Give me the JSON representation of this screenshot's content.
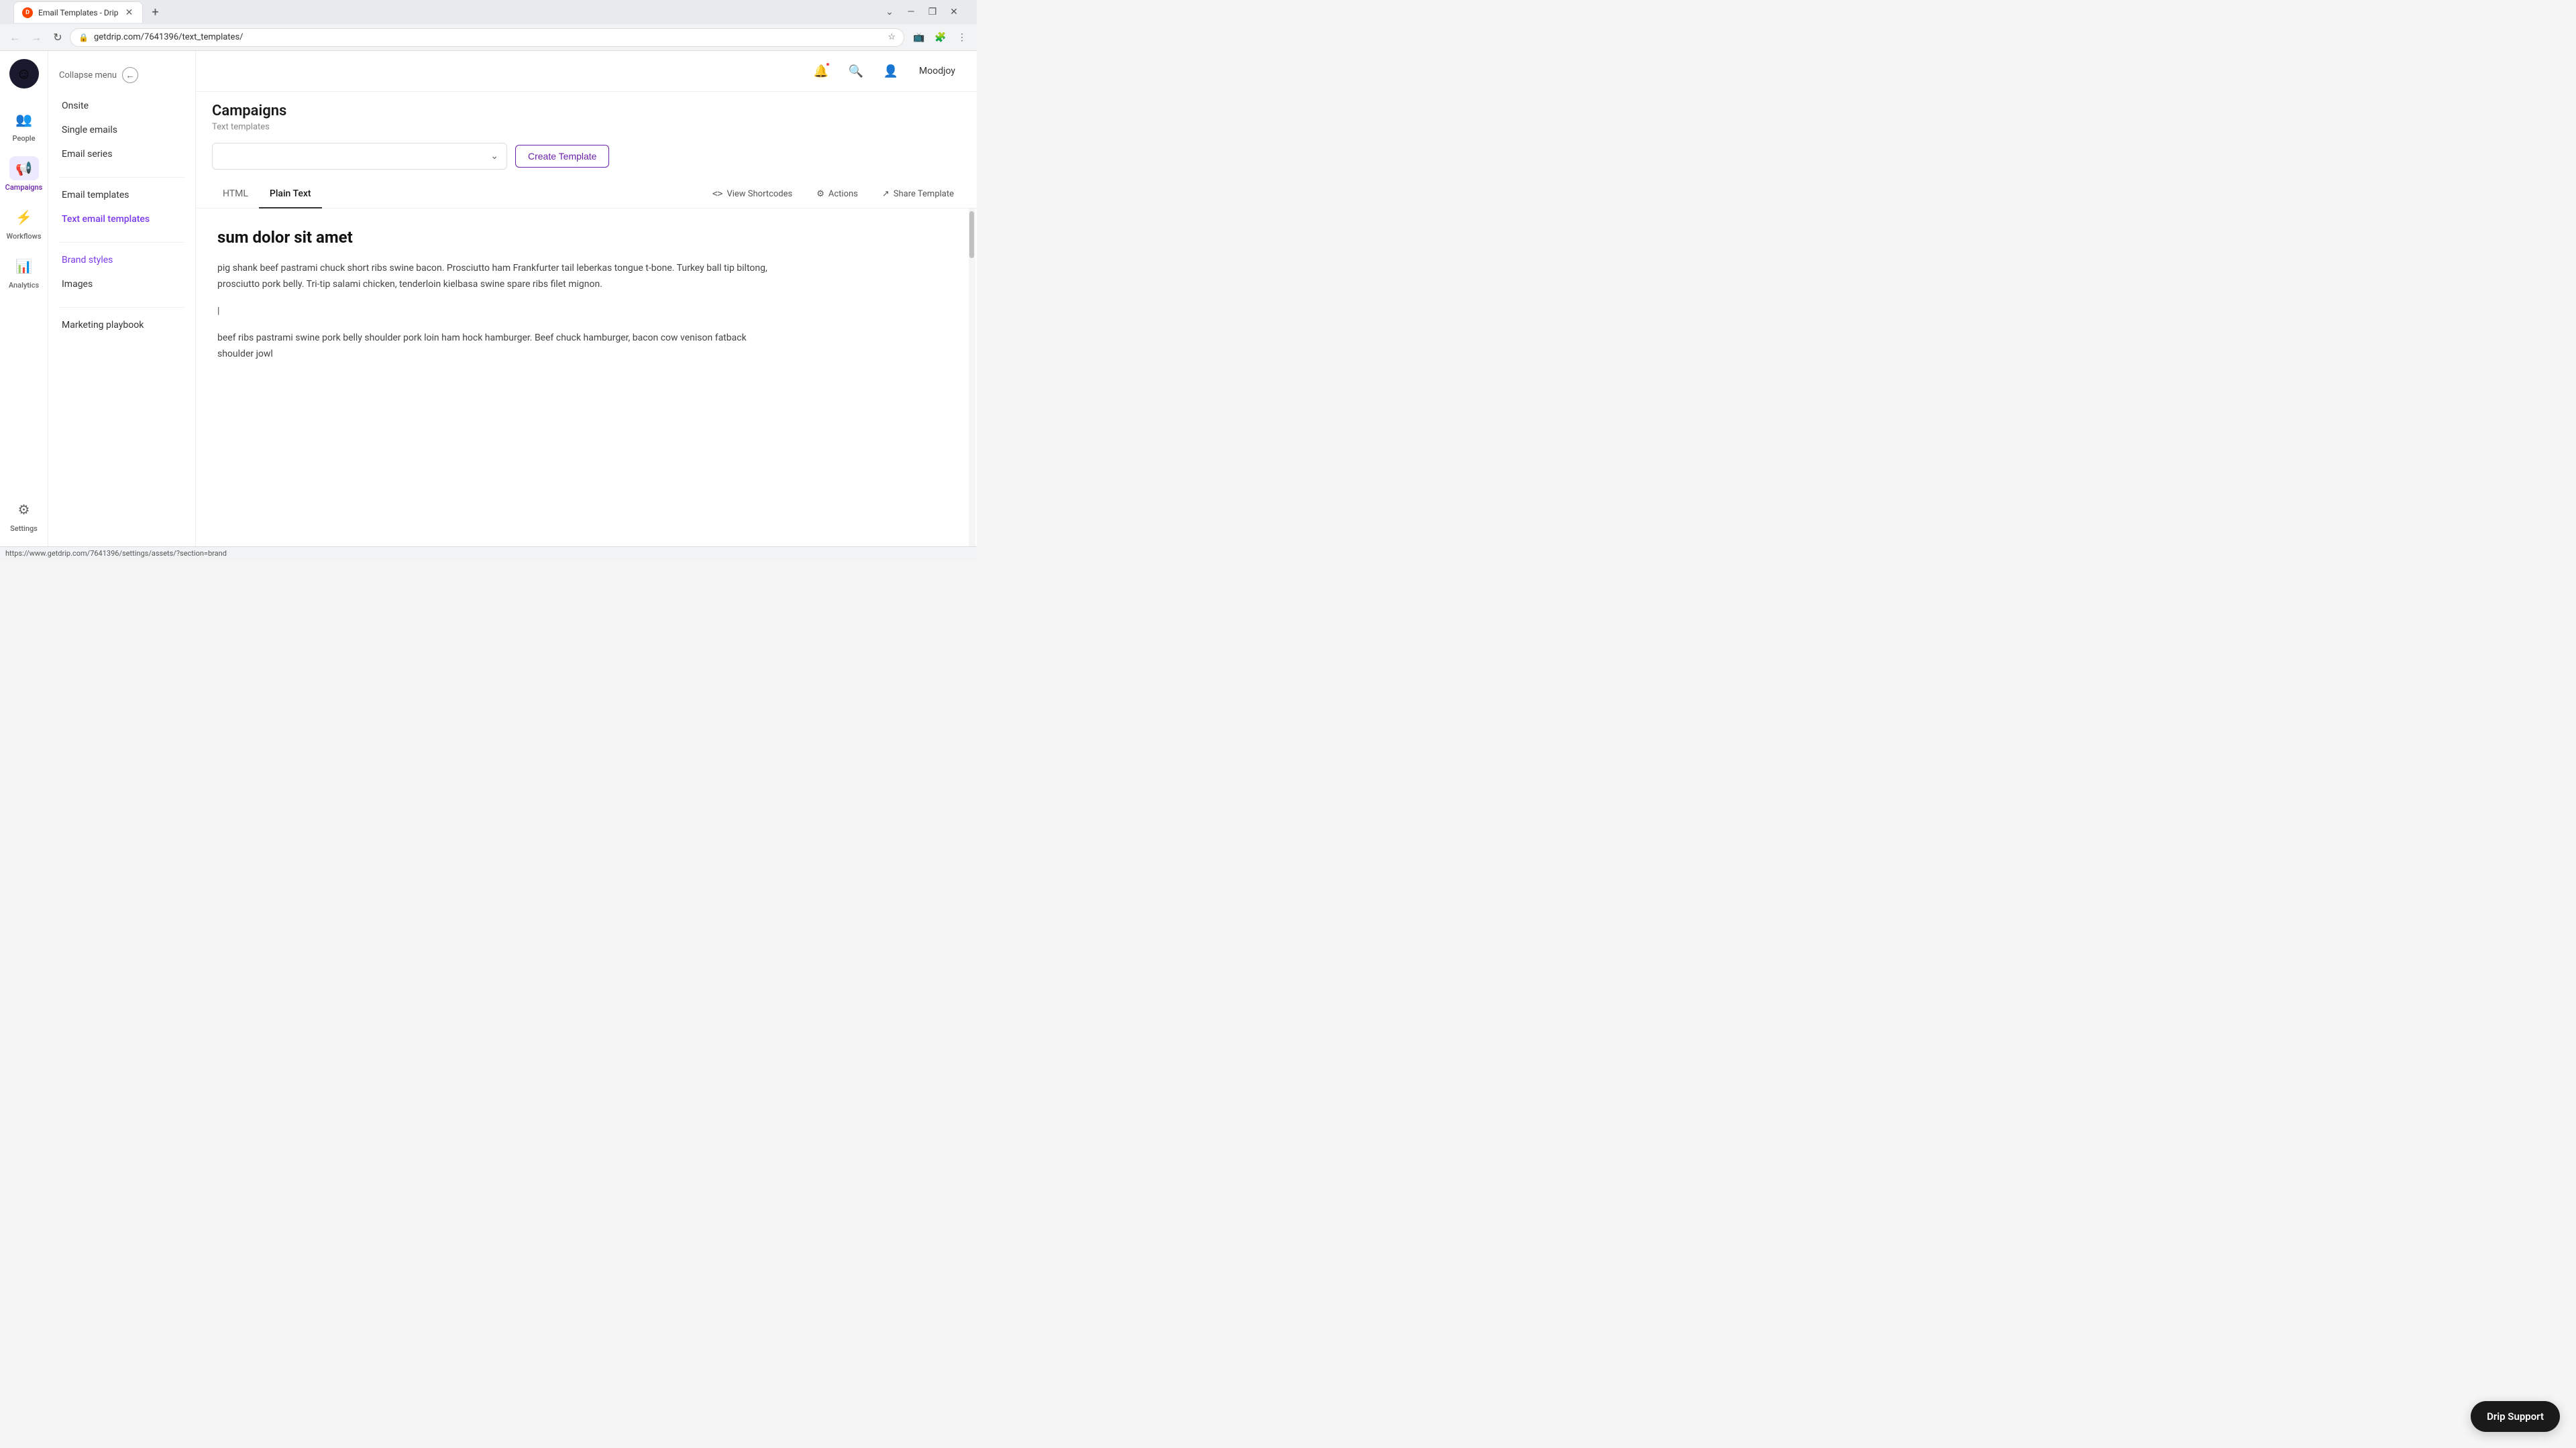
{
  "browser": {
    "tab_title": "Email Templates - Drip",
    "tab_favicon": "D",
    "address": "getdrip.com/7641396/text_templates/",
    "window_controls": {
      "minimize": "—",
      "maximize": "❐",
      "close": "✕"
    },
    "tab_arrows": "⌄",
    "back_btn": "←",
    "forward_btn": "→",
    "refresh_btn": "↻",
    "extensions": [
      "☰"
    ]
  },
  "topbar": {
    "notification_label": "notifications",
    "search_label": "search",
    "user_label": "Moodjoy"
  },
  "sidebar": {
    "collapse_label": "Collapse menu",
    "logo_emoji": "☺",
    "nav_items": [
      {
        "id": "people",
        "label": "People",
        "icon": "👥"
      },
      {
        "id": "campaigns",
        "label": "Campaigns",
        "icon": "📢",
        "active": true
      },
      {
        "id": "workflows",
        "label": "Workflows",
        "icon": "⚡"
      },
      {
        "id": "analytics",
        "label": "Analytics",
        "icon": "📊"
      }
    ],
    "settings": {
      "id": "settings",
      "label": "Settings",
      "icon": "⚙"
    }
  },
  "sub_sidebar": {
    "sections": [
      {
        "items": [
          {
            "id": "onsite",
            "label": "Onsite"
          },
          {
            "id": "single-emails",
            "label": "Single emails"
          },
          {
            "id": "email-series",
            "label": "Email series"
          }
        ]
      },
      {
        "items": [
          {
            "id": "email-templates",
            "label": "Email templates"
          },
          {
            "id": "text-email-templates",
            "label": "Text email templates",
            "active": true
          }
        ]
      },
      {
        "items": [
          {
            "id": "brand-styles",
            "label": "Brand styles",
            "hover": true
          },
          {
            "id": "images",
            "label": "Images"
          }
        ]
      },
      {
        "items": [
          {
            "id": "marketing-playbook",
            "label": "Marketing playbook"
          }
        ]
      }
    ]
  },
  "page": {
    "title": "Campaigns",
    "breadcrumb": "Text templates",
    "filter": {
      "placeholder": "",
      "dropdown_icon": "⌄"
    },
    "create_btn": "Create Template",
    "tabs": [
      {
        "id": "html",
        "label": "HTML"
      },
      {
        "id": "plain-text",
        "label": "Plain Text",
        "active": true
      }
    ],
    "actions": {
      "view_shortcodes_icon": "<>",
      "view_shortcodes_label": "View Shortcodes",
      "actions_icon": "⚙",
      "actions_label": "Actions",
      "share_icon": "↗",
      "share_label": "Share Template"
    },
    "preview": {
      "heading": "sum dolor sit amet",
      "paragraph1": "pig shank beef pastrami chuck short ribs swine bacon. Prosciutto ham Frankfurter tail leberkas tongue t-bone. Turkey ball tip biltong, prosciutto pork belly. Tri-tip salami chicken, tenderloin kielbasa swine spare ribs filet mignon.",
      "cursor_after_p1": true,
      "section_marker": "|",
      "paragraph2": "beef ribs pastrami swine pork belly shoulder pork loin ham hock hamburger. Beef chuck hamburger, bacon cow venison fatback shoulder jowl"
    }
  },
  "drip_support": {
    "label": "Drip Support"
  },
  "status_bar": {
    "url": "https://www.getdrip.com/7641396/settings/assets/?section=brand"
  }
}
